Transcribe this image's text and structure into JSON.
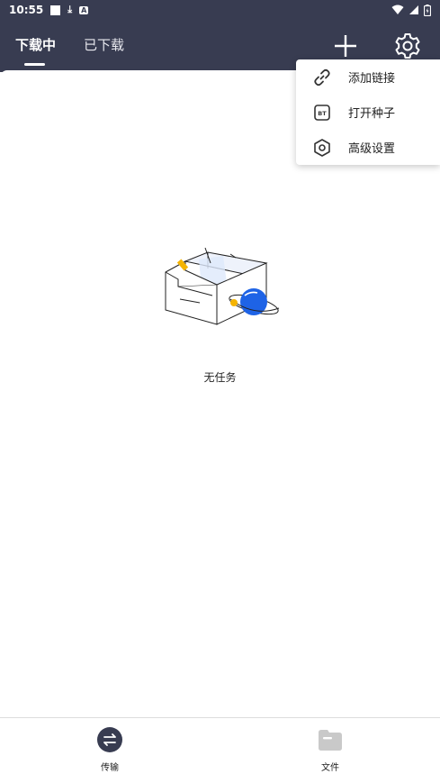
{
  "status_bar": {
    "time": "10:55",
    "download_symbol": "⤓",
    "app_badge": "A"
  },
  "tabs": [
    {
      "label": "下载中"
    },
    {
      "label": "已下载"
    }
  ],
  "menu": {
    "items": [
      {
        "label": "添加链接",
        "icon": "link-icon"
      },
      {
        "label": "打开种子",
        "icon": "bt-icon",
        "icon_text": "BT"
      },
      {
        "label": "高级设置",
        "icon": "hexagon-settings-icon"
      }
    ]
  },
  "empty_state": {
    "text": "无任务",
    "icon": "empty-box-planet-illustration"
  },
  "bottom_nav": [
    {
      "label": "传输",
      "icon": "transfer-icon"
    },
    {
      "label": "文件",
      "icon": "folder-icon"
    }
  ],
  "colors": {
    "header_bg": "#383c51",
    "accent_blue": "#1e63e6",
    "accent_yellow": "#f5b400"
  }
}
